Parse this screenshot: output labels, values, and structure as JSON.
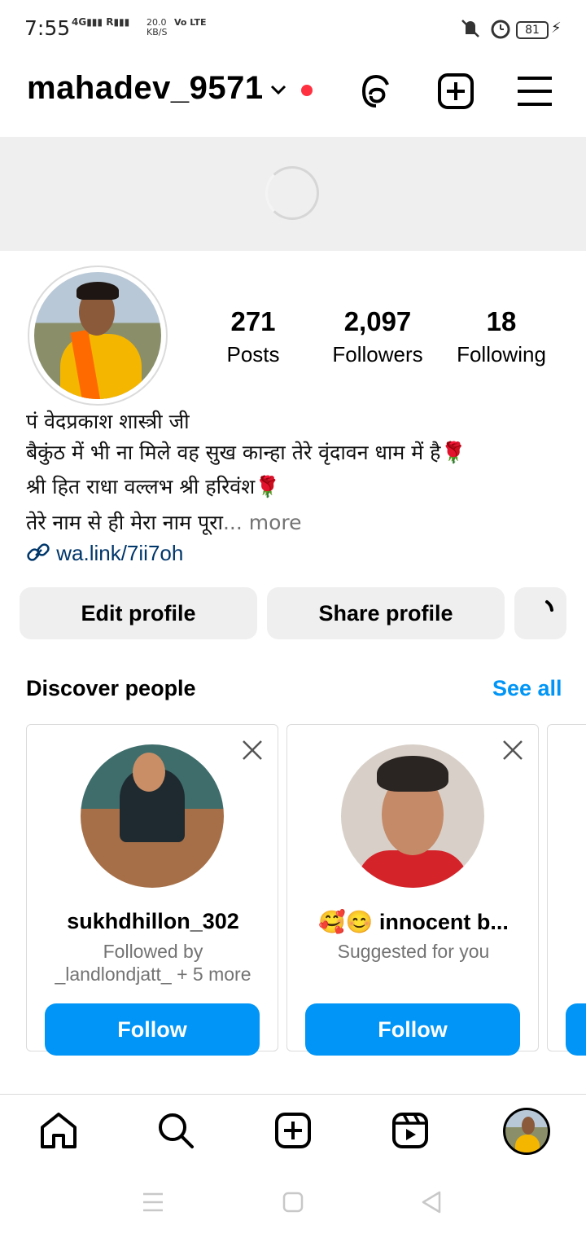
{
  "status_bar": {
    "time": "7:55",
    "network": "4G",
    "network_r": "R",
    "speed_value": "20.0",
    "speed_unit": "KB/S",
    "volte": "Vo LTE",
    "battery": "81"
  },
  "header": {
    "username": "mahadev_9571",
    "icons": [
      "chevron-down-icon",
      "threads-icon",
      "create-icon",
      "menu-icon"
    ]
  },
  "profile": {
    "stats": [
      {
        "value": "271",
        "label": "Posts"
      },
      {
        "value": "2,097",
        "label": "Followers"
      },
      {
        "value": "18",
        "label": "Following"
      }
    ],
    "bio": {
      "name": "पं वेदप्रकाश शास्त्री जी",
      "line1": "बैकुंठ में भी ना मिले वह सुख कान्हा तेरे वृंदावन धाम में है🌹",
      "line2": "श्री हित राधा वल्लभ श्री हरिवंश🌹",
      "line3": "तेरे नाम से ही मेरा नाम पूरा",
      "more": "... more"
    },
    "link": "wa.link/7ii7oh"
  },
  "actions": {
    "edit_profile": "Edit profile",
    "share_profile": "Share profile"
  },
  "discover": {
    "title": "Discover people",
    "see_all": "See all",
    "cards": [
      {
        "username": "sukhdhillon_302",
        "subtitle_line1": "Followed by",
        "subtitle_line2": "_landlondjatt_ + 5 more",
        "follow": "Follow"
      },
      {
        "username": "🥰😊 innocent b...",
        "subtitle_line1": "Suggested for you",
        "subtitle_line2": "",
        "follow": "Follow"
      }
    ]
  },
  "bottom_nav": [
    "home-icon",
    "search-icon",
    "create-icon",
    "reels-icon",
    "profile-avatar"
  ],
  "colors": {
    "accent": "#0095f6",
    "link": "#00376b",
    "notif_dot": "#ff3040"
  }
}
